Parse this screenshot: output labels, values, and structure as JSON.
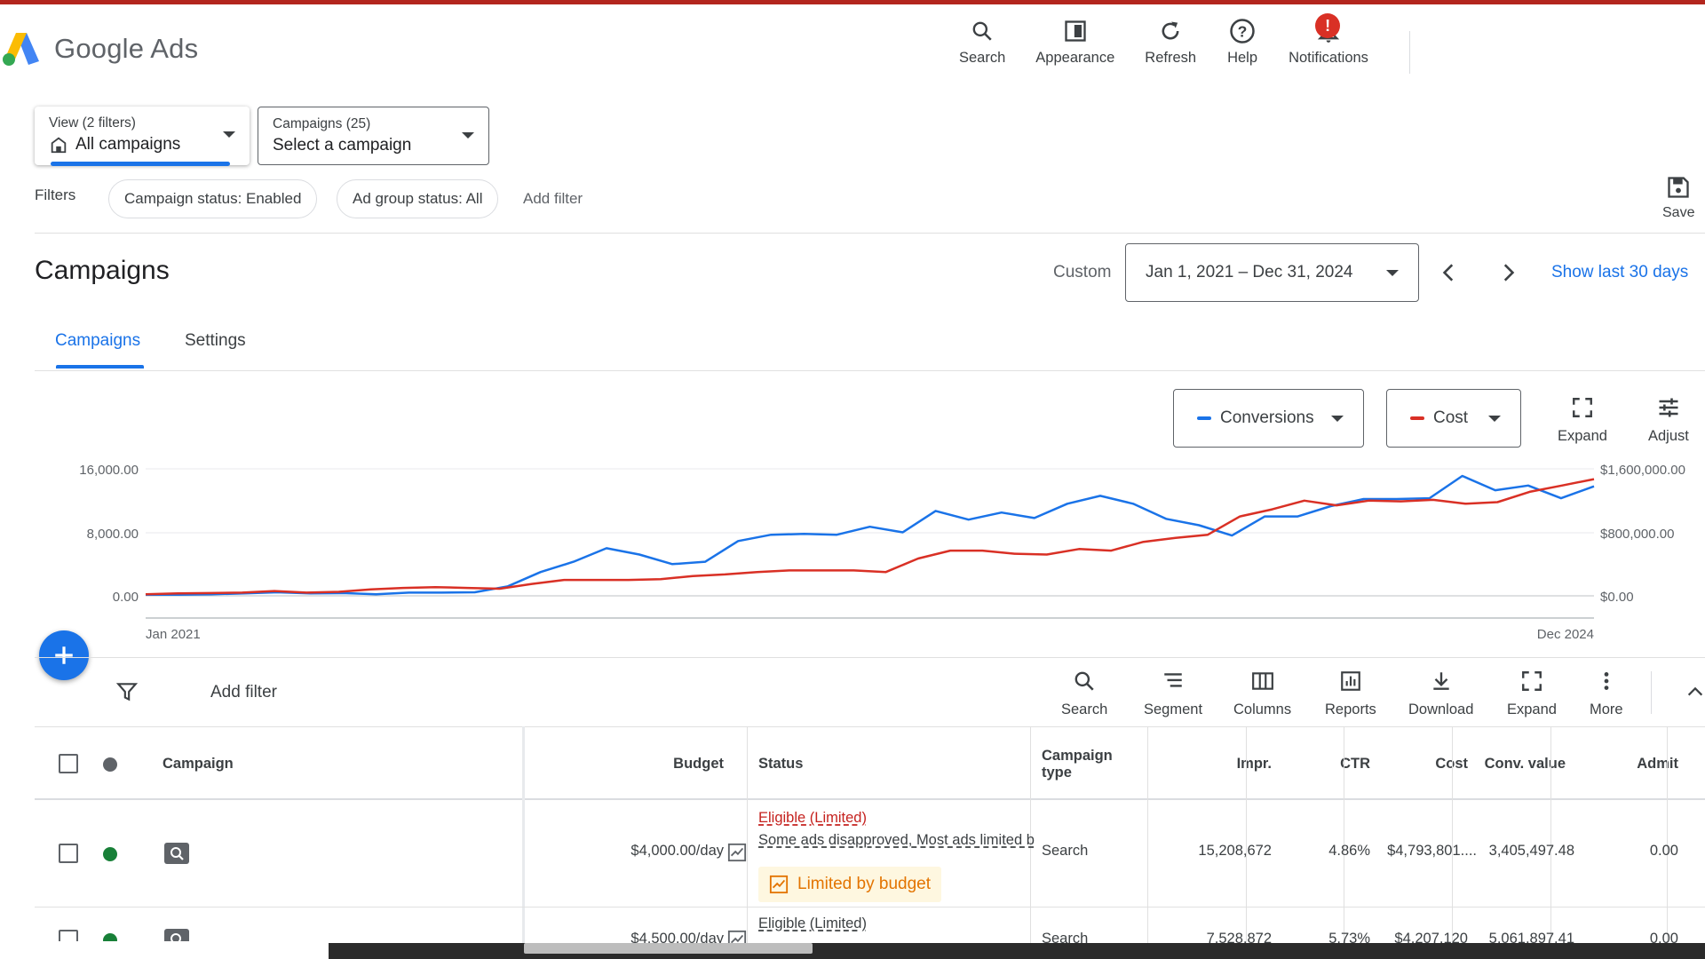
{
  "app": {
    "name": "Google Ads"
  },
  "top_actions": [
    {
      "label": "Search",
      "icon": "search-icon"
    },
    {
      "label": "Appearance",
      "icon": "appearance-icon"
    },
    {
      "label": "Refresh",
      "icon": "refresh-icon"
    },
    {
      "label": "Help",
      "icon": "help-icon"
    },
    {
      "label": "Notifications",
      "icon": "bell-icon",
      "badge": "!"
    }
  ],
  "view_selector": {
    "small": "View (2 filters)",
    "main": "All campaigns"
  },
  "campaign_selector": {
    "small": "Campaigns (25)",
    "main": "Select a campaign"
  },
  "filters": {
    "label": "Filters",
    "chips": [
      "Campaign status: Enabled",
      "Ad group status: All"
    ],
    "add_filter": "Add filter",
    "save_label": "Save"
  },
  "page": {
    "title": "Campaigns",
    "custom_label": "Custom",
    "date_range": "Jan 1, 2021 – Dec 31, 2024",
    "show_last": "Show last 30 days"
  },
  "tabs": [
    {
      "label": "Campaigns",
      "active": true
    },
    {
      "label": "Settings",
      "active": false
    }
  ],
  "chart_controls": {
    "metric1": {
      "label": "Conversions",
      "color": "#1a73e8"
    },
    "metric2": {
      "label": "Cost",
      "color": "#d93025"
    },
    "expand_label": "Expand",
    "adjust_label": "Adjust"
  },
  "chart_data": {
    "type": "line",
    "x_start_label": "Jan 2021",
    "x_end_label": "Dec 2024",
    "left_axis": {
      "ticks": [
        "16,000.00",
        "8,000.00",
        "0.00"
      ],
      "ylim": [
        0,
        16000
      ]
    },
    "right_axis": {
      "ticks": [
        "$1,600,000.00",
        "$800,000.00",
        "$0.00"
      ],
      "ylim": [
        0,
        1600000
      ]
    },
    "series": [
      {
        "name": "Conversions",
        "color": "#1a73e8",
        "axis": "left",
        "values": [
          150,
          150,
          200,
          300,
          450,
          300,
          350,
          200,
          400,
          400,
          450,
          1200,
          3000,
          4300,
          6000,
          5200,
          4000,
          4300,
          6900,
          7700,
          7800,
          7700,
          8700,
          8000,
          10700,
          9600,
          10500,
          9800,
          11600,
          12600,
          11600,
          9700,
          8900,
          7600,
          10000,
          10000,
          11300,
          12200,
          12200,
          12300,
          15100,
          13300,
          13900,
          12300,
          13800
        ]
      },
      {
        "name": "Cost",
        "color": "#d93025",
        "axis": "right",
        "values": [
          20000,
          30000,
          35000,
          40000,
          60000,
          40000,
          50000,
          80000,
          100000,
          110000,
          100000,
          90000,
          150000,
          200000,
          200000,
          200000,
          210000,
          250000,
          270000,
          300000,
          320000,
          320000,
          320000,
          300000,
          470000,
          570000,
          570000,
          530000,
          520000,
          590000,
          570000,
          680000,
          730000,
          770000,
          1000000,
          1090000,
          1200000,
          1140000,
          1200000,
          1190000,
          1210000,
          1160000,
          1180000,
          1310000,
          1390000,
          1470000
        ]
      }
    ]
  },
  "table_toolbar": {
    "add_filter": "Add filter",
    "tools": [
      "Search",
      "Segment",
      "Columns",
      "Reports",
      "Download",
      "Expand",
      "More"
    ]
  },
  "table": {
    "columns": [
      "Campaign",
      "Budget",
      "Status",
      "Campaign type",
      "Impr.",
      "CTR",
      "Cost",
      "Conv. value",
      "Admit"
    ],
    "rows": [
      {
        "budget": "$4,000.00/day",
        "status_main": "Eligible (Limited)",
        "status_sub": "Some ads disapproved, Most ads limited b",
        "status_badge": "Limited by budget",
        "type": "Search",
        "impr": "15,208,672",
        "ctr": "4.86%",
        "cost": "$4,793,801....",
        "conv_value": "3,405,497.48",
        "admit": "0.00"
      },
      {
        "budget": "$4,500.00/day",
        "status_main": "Eligible (Limited)",
        "type": "Search",
        "impr": "7,528,872",
        "ctr": "5.73%",
        "cost": "$4,207,120",
        "conv_value": "5,061,897.41",
        "admit": "0.00"
      }
    ]
  }
}
